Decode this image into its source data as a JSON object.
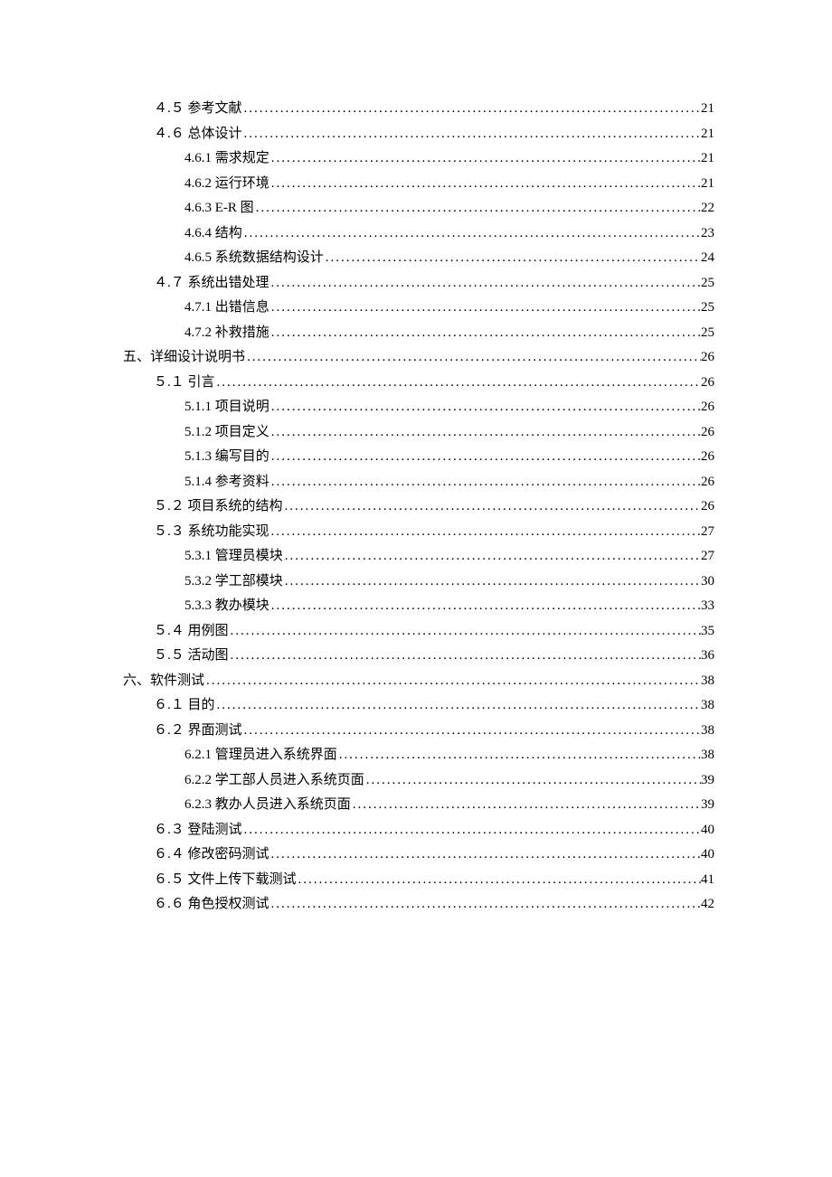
{
  "toc": [
    {
      "indent": 1,
      "title": "４.５ 参考文献",
      "page": "21"
    },
    {
      "indent": 1,
      "title": "４.６ 总体设计",
      "page": "21"
    },
    {
      "indent": 2,
      "title": "4.6.1 需求规定",
      "page": "21"
    },
    {
      "indent": 2,
      "title": "4.6.2 运行环境",
      "page": "21"
    },
    {
      "indent": 2,
      "title": "4.6.3 E-R 图",
      "page": "22"
    },
    {
      "indent": 2,
      "title": "4.6.4 结构",
      "page": "23"
    },
    {
      "indent": 2,
      "title": "4.6.5 系统数据结构设计",
      "page": "24"
    },
    {
      "indent": 1,
      "title": "４.７ 系统出错处理",
      "page": "25"
    },
    {
      "indent": 2,
      "title": "4.7.1 出错信息",
      "page": "25"
    },
    {
      "indent": 2,
      "title": "4.7.2 补救措施",
      "page": "25"
    },
    {
      "indent": 0,
      "title": "五、详细设计说明书",
      "page": "26"
    },
    {
      "indent": 1,
      "title": "５.１ 引言",
      "page": "26"
    },
    {
      "indent": 2,
      "title": "5.1.1 项目说明",
      "page": "26"
    },
    {
      "indent": 2,
      "title": "5.1.2 项目定义",
      "page": "26"
    },
    {
      "indent": 2,
      "title": "5.1.3 编写目的",
      "page": "26"
    },
    {
      "indent": 2,
      "title": "5.1.4 参考资料",
      "page": "26"
    },
    {
      "indent": 1,
      "title": "５.２ 项目系统的结构",
      "page": "26"
    },
    {
      "indent": 1,
      "title": "５.３ 系统功能实现",
      "page": "27"
    },
    {
      "indent": 2,
      "title": "5.3.1 管理员模块",
      "page": "27"
    },
    {
      "indent": 2,
      "title": "5.3.2 学工部模块",
      "page": "30"
    },
    {
      "indent": 2,
      "title": "5.3.3 教办模块",
      "page": "33"
    },
    {
      "indent": 1,
      "title": "５.４ 用例图",
      "page": "35"
    },
    {
      "indent": 1,
      "title": "５.５ 活动图",
      "page": "36"
    },
    {
      "indent": 0,
      "title": "六、软件测试",
      "page": "38"
    },
    {
      "indent": 1,
      "title": "６.１ 目的",
      "page": "38"
    },
    {
      "indent": 1,
      "title": "６.２ 界面测试",
      "page": "38"
    },
    {
      "indent": 2,
      "title": "6.2.1 管理员进入系统界面",
      "page": "38"
    },
    {
      "indent": 2,
      "title": "6.2.2 学工部人员进入系统页面",
      "page": "39"
    },
    {
      "indent": 2,
      "title": "6.2.3 教办人员进入系统页面",
      "page": "39"
    },
    {
      "indent": 1,
      "title": "６.３ 登陆测试",
      "page": "40"
    },
    {
      "indent": 1,
      "title": "６.４ 修改密码测试",
      "page": "40"
    },
    {
      "indent": 1,
      "title": "６.５ 文件上传下载测试",
      "page": "41"
    },
    {
      "indent": 1,
      "title": "６.６ 角色授权测试",
      "page": "42"
    }
  ],
  "leader": "............................................................................................................................................................................"
}
